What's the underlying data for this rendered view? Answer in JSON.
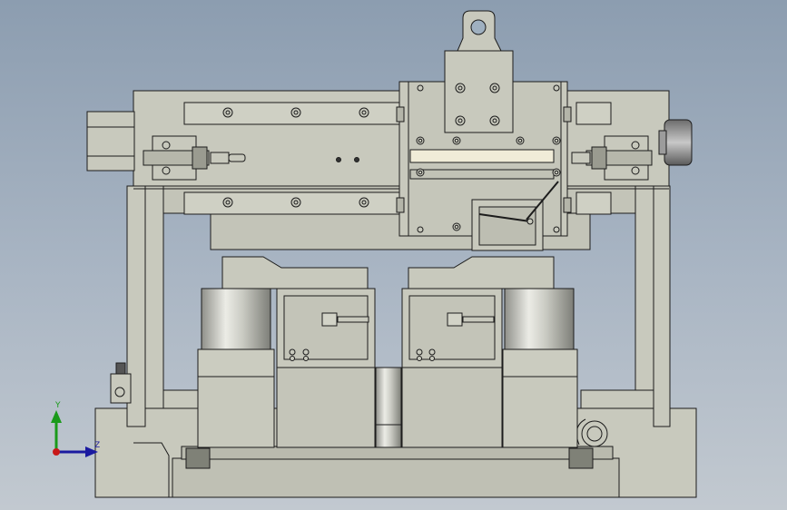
{
  "viewport": {
    "background_top": "#8c9db0",
    "background_bottom": "#c2c9d0",
    "part_fill": "#c8c9bd",
    "part_fill_dark": "#a9aa9f",
    "edge_color": "#1c1c1c",
    "cylinder_highlight": "#e8e8e2",
    "slot_fill": "#f0ecd8"
  },
  "triad": {
    "y_label": "Y",
    "z_label": "Z",
    "y_color": "#1a9a1a",
    "z_color": "#1a1aa0",
    "x_color": "#c81818"
  }
}
